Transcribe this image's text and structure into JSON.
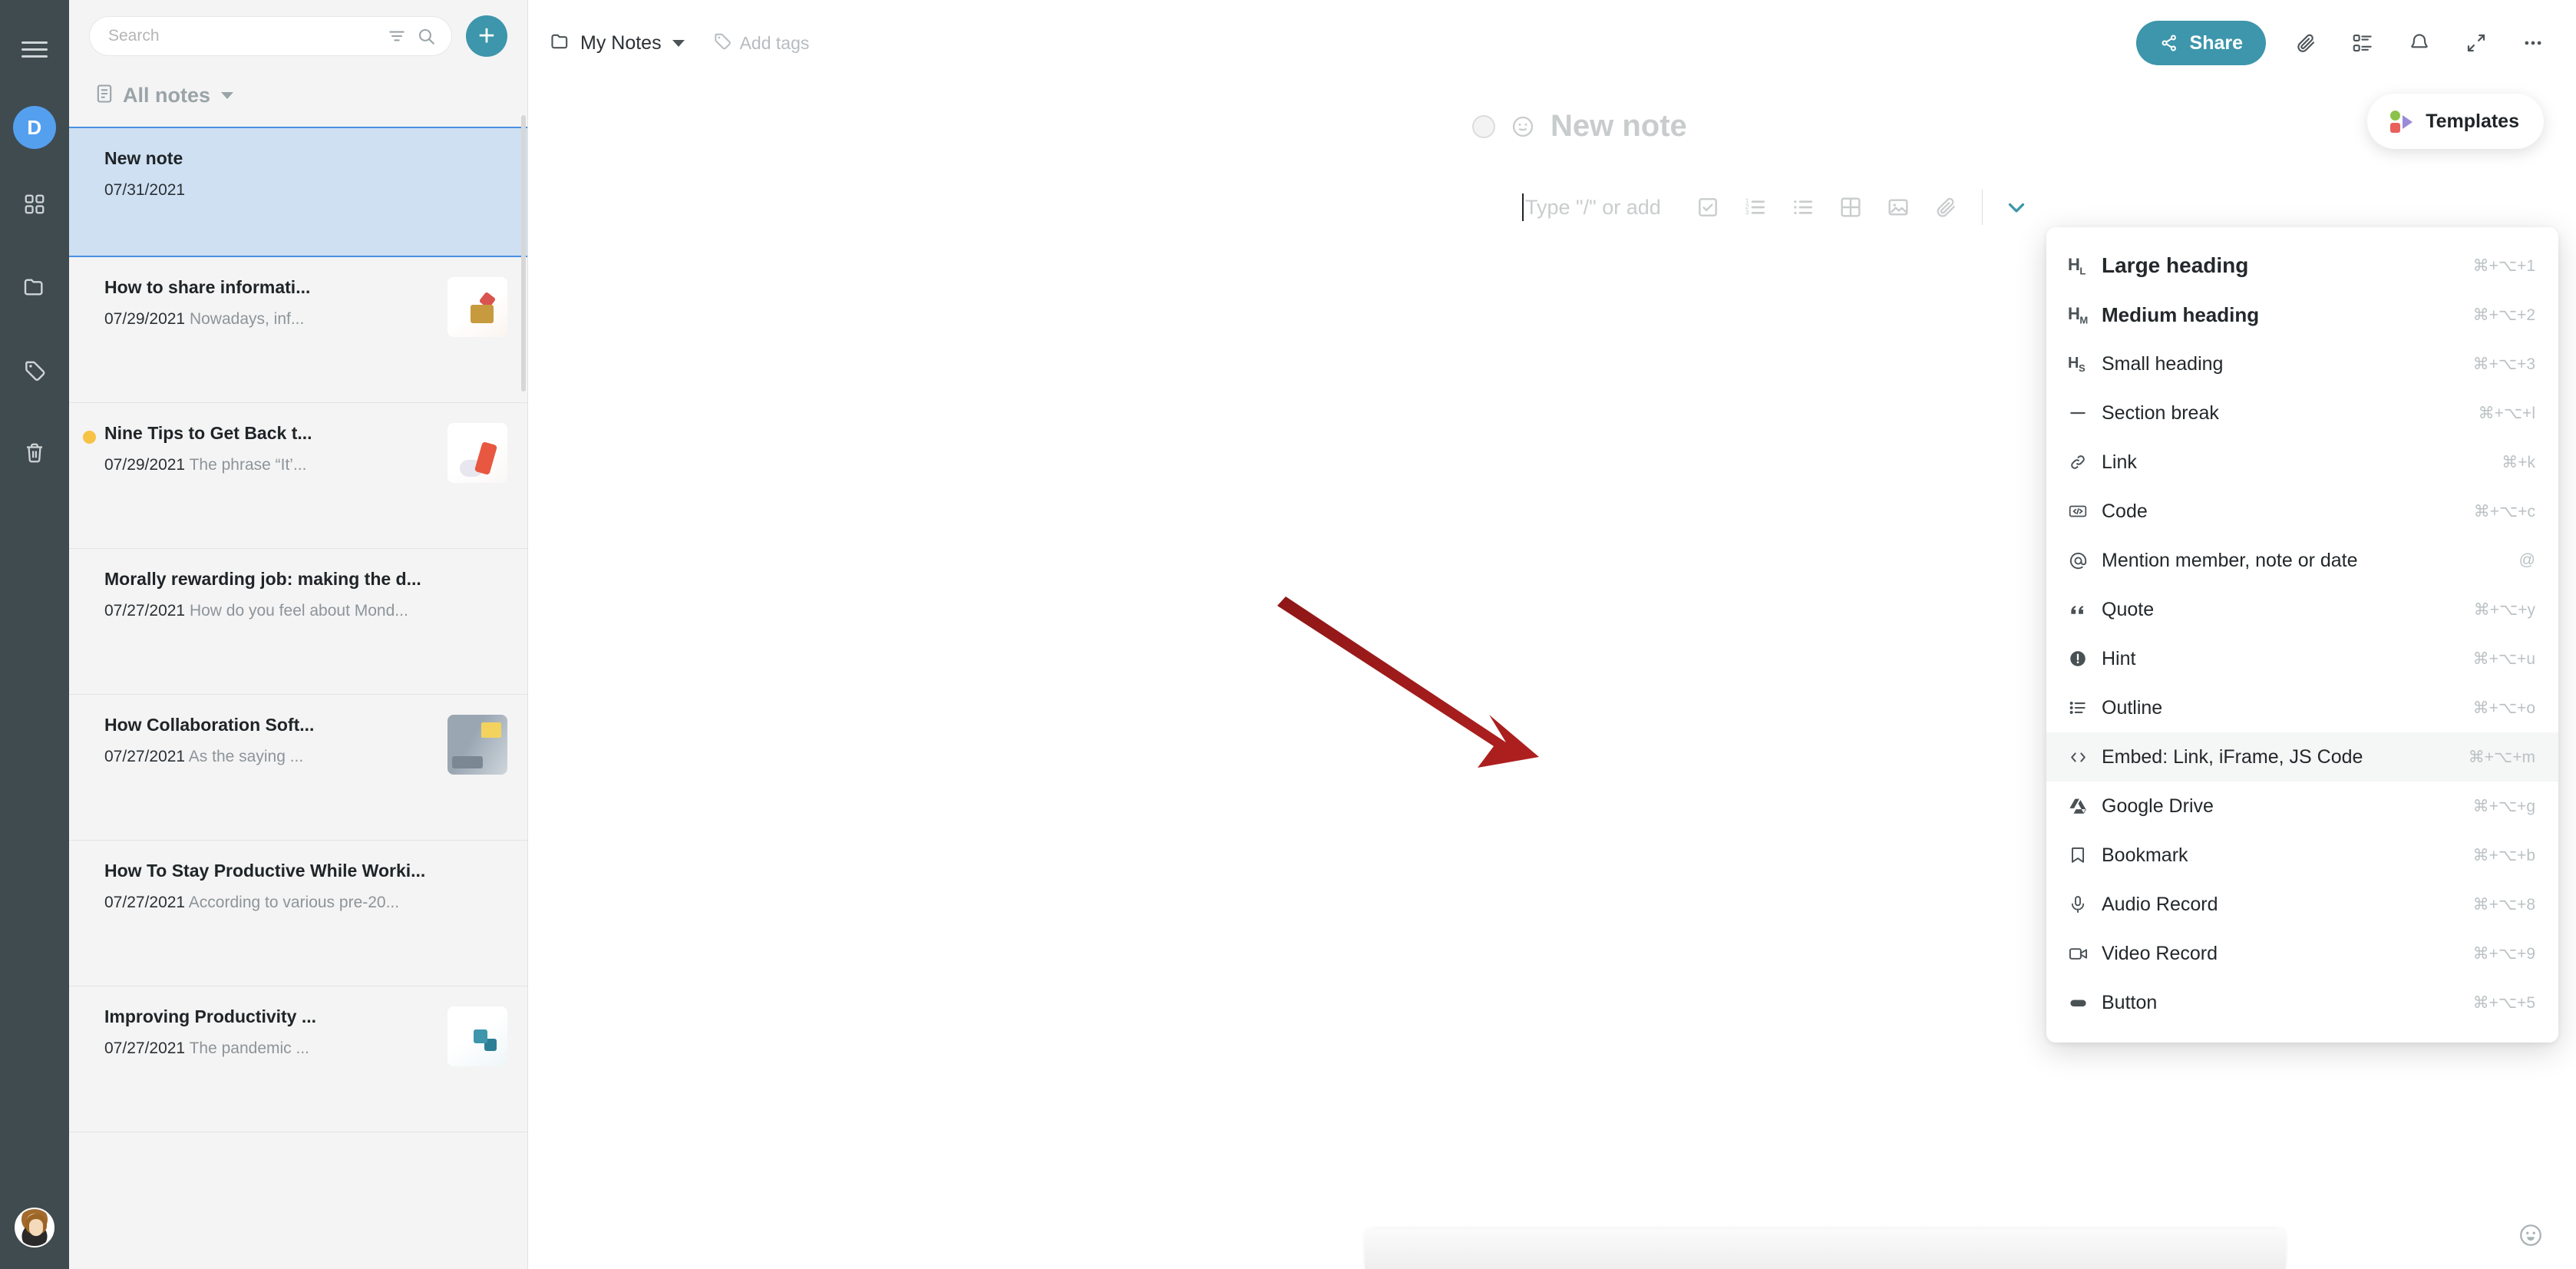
{
  "rail": {
    "menu_icon": "hamburger-icon",
    "workspace_initial": "D",
    "items": [
      {
        "name": "apps-grid-icon"
      },
      {
        "name": "folder-icon"
      },
      {
        "name": "tag-icon"
      },
      {
        "name": "trash-icon"
      }
    ],
    "user_avatar": "user-avatar"
  },
  "sidebar": {
    "search": {
      "placeholder": "Search",
      "value": "",
      "filter_icon": "filter-icon",
      "search_icon": "search-icon"
    },
    "add_button": "+",
    "folder": {
      "label": "All notes",
      "icon": "notes-list-icon",
      "caret": "chevron-down-icon"
    },
    "notes": [
      {
        "title": "New note",
        "date": "07/31/2021",
        "excerpt": "",
        "selected": true,
        "dot": false,
        "thumb": null
      },
      {
        "title": "How to share informati...",
        "date": "07/29/2021",
        "excerpt": "Nowadays, inf...",
        "selected": false,
        "dot": false,
        "thumb": "t1"
      },
      {
        "title": "Nine Tips to Get Back t...",
        "date": "07/29/2021",
        "excerpt": "The phrase “It’...",
        "selected": false,
        "dot": true,
        "thumb": "t2"
      },
      {
        "title": "Morally rewarding job: making the d...",
        "date": "07/27/2021",
        "excerpt": "How do you feel about Mond...",
        "selected": false,
        "dot": false,
        "thumb": null
      },
      {
        "title": "How Collaboration Soft...",
        "date": "07/27/2021",
        "excerpt": "As the saying ...",
        "selected": false,
        "dot": false,
        "thumb": "t3"
      },
      {
        "title": "How To Stay Productive While Worki...",
        "date": "07/27/2021",
        "excerpt": "According to various pre-20...",
        "selected": false,
        "dot": false,
        "thumb": null
      },
      {
        "title": "Improving Productivity ...",
        "date": "07/27/2021",
        "excerpt": "The pandemic ...",
        "selected": false,
        "dot": false,
        "thumb": "t4"
      }
    ]
  },
  "topbar": {
    "breadcrumb": {
      "label": "My Notes",
      "icon": "folder-icon",
      "caret": "chevron-down-icon"
    },
    "add_tags": {
      "label": "Add tags",
      "icon": "tag-icon"
    },
    "share": {
      "label": "Share",
      "icon": "share-nodes-icon"
    },
    "icons": [
      {
        "name": "paperclip-icon"
      },
      {
        "name": "task-list-icon"
      },
      {
        "name": "bell-icon"
      },
      {
        "name": "expand-icon"
      },
      {
        "name": "more-horizontal-icon"
      }
    ],
    "templates": {
      "label": "Templates",
      "icon": "templates-icon"
    }
  },
  "document": {
    "title": "New note",
    "title_circle": "status-circle-icon",
    "title_emoji": "emoji-icon",
    "editor_placeholder": "Type \"/\" or add",
    "toolbar_icons": [
      {
        "name": "checklist-icon"
      },
      {
        "name": "ordered-list-icon"
      },
      {
        "name": "bullet-list-icon"
      },
      {
        "name": "table-icon"
      },
      {
        "name": "image-icon"
      },
      {
        "name": "paperclip-icon"
      }
    ],
    "expand_toolbar_icon": "chevron-down-icon"
  },
  "slash_menu": {
    "items": [
      {
        "label": "Large heading",
        "shortcut": "⌘+⌥+1",
        "icon": "heading-large-icon",
        "style": "lg",
        "highlighted": false
      },
      {
        "label": "Medium heading",
        "shortcut": "⌘+⌥+2",
        "icon": "heading-medium-icon",
        "style": "md",
        "highlighted": false
      },
      {
        "label": "Small heading",
        "shortcut": "⌘+⌥+3",
        "icon": "heading-small-icon",
        "style": "",
        "highlighted": false
      },
      {
        "label": "Section break",
        "shortcut": "⌘+⌥+l",
        "icon": "section-break-icon",
        "style": "",
        "highlighted": false
      },
      {
        "label": "Link",
        "shortcut": "⌘+k",
        "icon": "link-icon",
        "style": "",
        "highlighted": false
      },
      {
        "label": "Code",
        "shortcut": "⌘+⌥+c",
        "icon": "code-icon",
        "style": "",
        "highlighted": false
      },
      {
        "label": "Mention member, note or date",
        "shortcut": "@",
        "icon": "at-mention-icon",
        "style": "",
        "highlighted": false
      },
      {
        "label": "Quote",
        "shortcut": "⌘+⌥+y",
        "icon": "quote-icon",
        "style": "",
        "highlighted": false
      },
      {
        "label": "Hint",
        "shortcut": "⌘+⌥+u",
        "icon": "hint-icon",
        "style": "",
        "highlighted": false
      },
      {
        "label": "Outline",
        "shortcut": "⌘+⌥+o",
        "icon": "outline-icon",
        "style": "",
        "highlighted": false
      },
      {
        "label": "Embed: Link, iFrame, JS Code",
        "shortcut": "⌘+⌥+m",
        "icon": "embed-code-icon",
        "style": "",
        "highlighted": true
      },
      {
        "label": "Google Drive",
        "shortcut": "⌘+⌥+g",
        "icon": "google-drive-icon",
        "style": "",
        "highlighted": false
      },
      {
        "label": "Bookmark",
        "shortcut": "⌘+⌥+b",
        "icon": "bookmark-icon",
        "style": "",
        "highlighted": false
      },
      {
        "label": "Audio Record",
        "shortcut": "⌘+⌥+8",
        "icon": "microphone-icon",
        "style": "",
        "highlighted": false
      },
      {
        "label": "Video Record",
        "shortcut": "⌘+⌥+9",
        "icon": "video-camera-icon",
        "style": "",
        "highlighted": false
      },
      {
        "label": "Button",
        "shortcut": "⌘+⌥+5",
        "icon": "button-icon",
        "style": "",
        "highlighted": false
      }
    ]
  },
  "annotation": {
    "arrow_color": "#9c1c1c",
    "target": "Embed: Link, iFrame, JS Code"
  },
  "footer": {
    "feedback_icon": "smiley-icon"
  },
  "colors": {
    "accent": "#3d96ab",
    "selected_row": "#cfe0f3",
    "selected_border": "#4a90e2",
    "rail": "#404b4f",
    "badge_dot": "#f6c344",
    "avatar": "#54a0ef"
  }
}
